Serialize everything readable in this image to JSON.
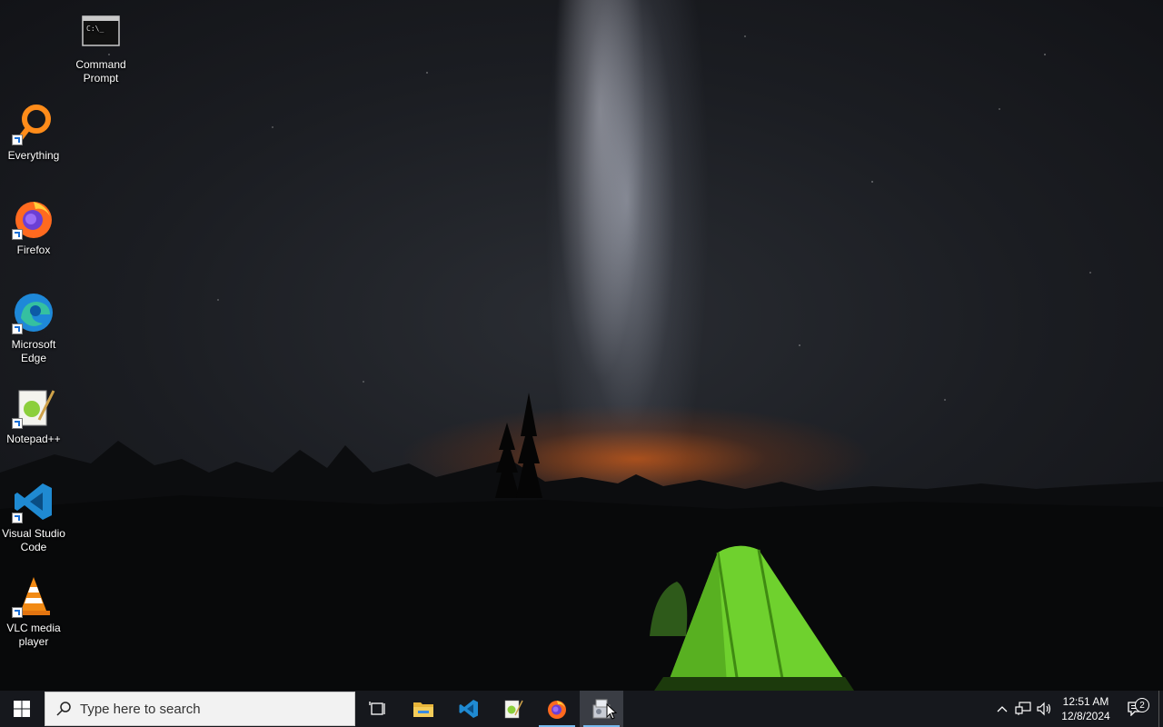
{
  "desktop": {
    "icons": [
      {
        "label": "Command Prompt",
        "icon": "command-prompt-icon"
      },
      {
        "label": "Everything",
        "icon": "everything-search-icon"
      },
      {
        "label": "Firefox",
        "icon": "firefox-icon"
      },
      {
        "label": "Microsoft Edge",
        "icon": "edge-icon"
      },
      {
        "label": "Notepad++",
        "icon": "notepadpp-icon"
      },
      {
        "label": "Visual Studio Code",
        "icon": "vscode-icon"
      },
      {
        "label": "VLC media player",
        "icon": "vlc-icon"
      }
    ]
  },
  "taskbar": {
    "search_placeholder": "Type here to search",
    "apps": [
      {
        "name": "Task View",
        "icon": "task-view-icon"
      },
      {
        "name": "File Explorer",
        "icon": "file-explorer-icon"
      },
      {
        "name": "Visual Studio Code",
        "icon": "vscode-icon",
        "running": false
      },
      {
        "name": "Notepad++",
        "icon": "notepadpp-icon",
        "running": false
      },
      {
        "name": "Firefox",
        "icon": "firefox-icon",
        "running": true
      },
      {
        "name": "Setup",
        "icon": "installer-icon",
        "running": true,
        "active": true
      }
    ],
    "tray": {
      "time": "12:51 AM",
      "date": "12/8/2024",
      "notification_count": "2"
    }
  },
  "colors": {
    "taskbar_bg": "#16181d",
    "accent": "#76b9ed"
  }
}
